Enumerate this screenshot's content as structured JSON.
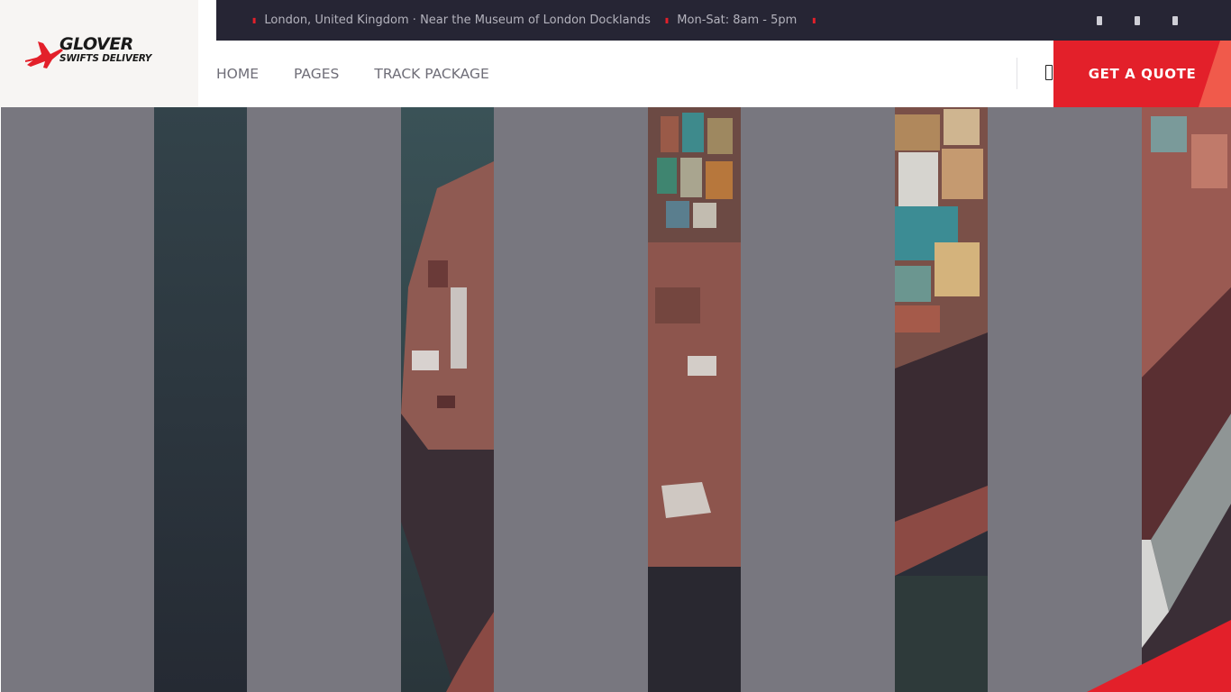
{
  "brand": {
    "name_main": "GLOVER",
    "name_sub": "SWIFTS DELIVERY",
    "logo_icon": "plane-logo-icon",
    "accent_color": "#e3202a"
  },
  "topbar": {
    "location": "London, United Kingdom · Near the Museum of London Docklands",
    "hours": "Mon-Sat: 8am - 5pm",
    "location_icon": "map-pin-icon",
    "hours_icon": "clock-icon",
    "socials": [
      "facebook-icon",
      "twitter-icon",
      "instagram-icon"
    ],
    "background_color": "#262534"
  },
  "nav": {
    "items": [
      {
        "label": "HOME"
      },
      {
        "label": "PAGES"
      },
      {
        "label": "TRACK PACKAGE"
      }
    ],
    "search_icon": "search-icon",
    "cta_label": "GET A QUOTE"
  },
  "hero": {
    "image": "aerial-container-ship-photo",
    "overlay_color": "#78777f"
  }
}
